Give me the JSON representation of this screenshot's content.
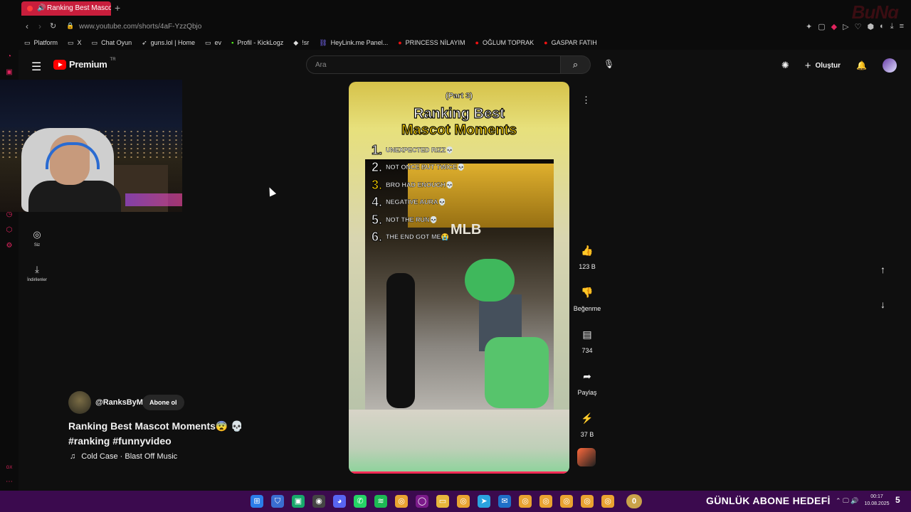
{
  "browser": {
    "tab_title": "Ranking Best Mascot M",
    "url": "www.youtube.com/shorts/4aF-YzzQbjo",
    "corner_logo": "BuNg"
  },
  "bookmarks": [
    {
      "label": "Platform",
      "icon": "folder-icon"
    },
    {
      "label": "X",
      "icon": "folder-icon"
    },
    {
      "label": "Chat Oyun",
      "icon": "folder-icon"
    },
    {
      "label": "guns.lol | Home",
      "icon": "gun-icon"
    },
    {
      "label": "ev",
      "icon": "folder-icon"
    },
    {
      "label": "Profil - KickLogz",
      "icon": "kick-icon"
    },
    {
      "label": "!sr",
      "icon": "diamond-icon"
    },
    {
      "label": "HeyLink.me Panel...",
      "icon": "link-icon"
    },
    {
      "label": "PRINCESS NİLAYIM",
      "icon": "red-icon"
    },
    {
      "label": "OĞLUM TOPRAK",
      "icon": "red-icon"
    },
    {
      "label": "GASPAR FATIH",
      "icon": "red-icon"
    }
  ],
  "header": {
    "brand": "Premium",
    "region": "TR",
    "search_placeholder": "Ara",
    "create_label": "Oluştur"
  },
  "sidebar": {
    "you_label": "Siz",
    "downloads_label": "İndirilenler"
  },
  "short": {
    "part": "(Part 3)",
    "title_line1": "Ranking Best",
    "title_line2": "Mascot Moments",
    "list": [
      {
        "n": "1.",
        "text": "UNEXPECTED RIZZ💀"
      },
      {
        "n": "2.",
        "text": "NOT ONCE BUT TWICE💀"
      },
      {
        "n": "3.",
        "text": "BRO HAD ENOUGH💀"
      },
      {
        "n": "4.",
        "text": "NEGATIVE AURA💀"
      },
      {
        "n": "5.",
        "text": "NOT THE RUN💀"
      },
      {
        "n": "6.",
        "text": "THE END GOT ME😭"
      }
    ],
    "store_sign": "MLB"
  },
  "actions": {
    "likes": "123 B",
    "dislike_label": "Beğenme",
    "comments": "734",
    "share_label": "Paylaş",
    "remix": "37 B"
  },
  "channel": {
    "handle": "@RanksByM",
    "subscribe_label": "Abone ol",
    "video_title": "Ranking Best Mascot Moments😨 💀 #ranking #funnyvideo",
    "music": "Cold Case · Blast Off Music"
  },
  "taskbar": {
    "counter": "0",
    "goal_text": "GÜNLÜK ABONE HEDEFİ",
    "time": "00:17",
    "date": "10.08.2025",
    "notifications": "5"
  }
}
